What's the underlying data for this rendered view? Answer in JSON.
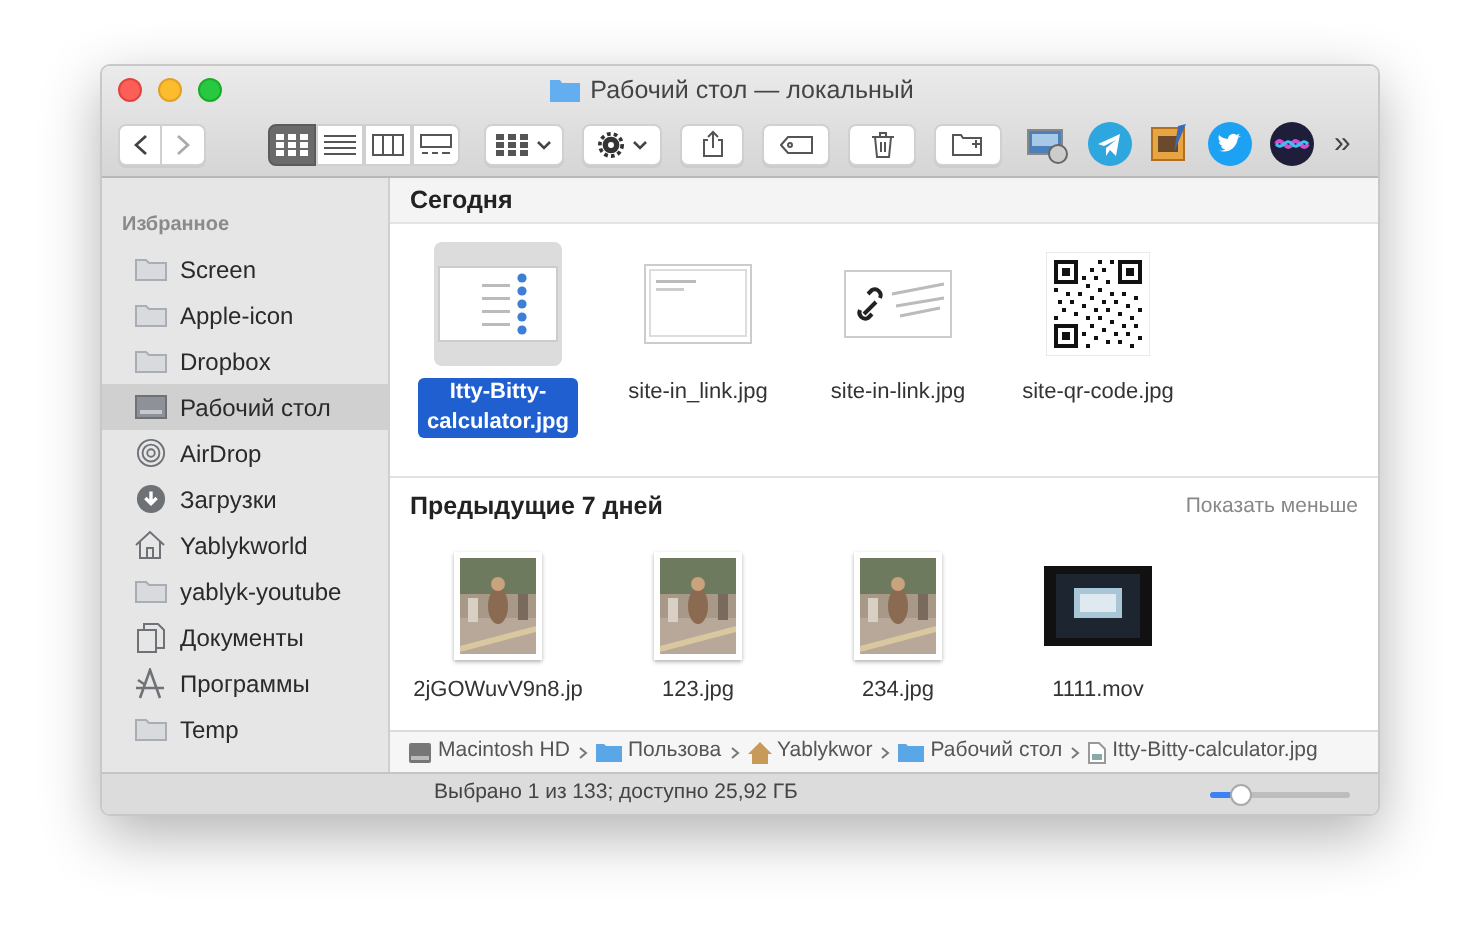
{
  "window": {
    "title": "Рабочий стол — локальный"
  },
  "toolbar": {
    "view_modes": [
      {
        "kind": "icons",
        "selected": true
      },
      {
        "kind": "list",
        "selected": false
      },
      {
        "kind": "columns",
        "selected": false
      },
      {
        "kind": "gallery",
        "selected": false
      }
    ],
    "overflow": "»"
  },
  "sidebar": {
    "section": "Избранное",
    "items": [
      {
        "label": "Screen",
        "kind": "folder",
        "selected": false
      },
      {
        "label": "Apple-icon",
        "kind": "folder",
        "selected": false
      },
      {
        "label": "Dropbox",
        "kind": "folder",
        "selected": false
      },
      {
        "label": "Рабочий стол",
        "kind": "desktop",
        "selected": true
      },
      {
        "label": "AirDrop",
        "kind": "airdrop",
        "selected": false
      },
      {
        "label": "Загрузки",
        "kind": "download",
        "selected": false
      },
      {
        "label": "Yablykworld",
        "kind": "home",
        "selected": false
      },
      {
        "label": "yablyk-youtube",
        "kind": "folder",
        "selected": false
      },
      {
        "label": "Документы",
        "kind": "documents",
        "selected": false
      },
      {
        "label": "Программы",
        "kind": "apps",
        "selected": false
      },
      {
        "label": "Temp",
        "kind": "folder",
        "selected": false
      }
    ]
  },
  "sections": [
    {
      "title": "Сегодня",
      "files": [
        {
          "name": "Itty-Bitty-calculator.jpg",
          "kind": "calculator",
          "selected": true
        },
        {
          "name": "site-in_link.jpg",
          "kind": "screenshot",
          "selected": false
        },
        {
          "name": "site-in-link.jpg",
          "kind": "link",
          "selected": false
        },
        {
          "name": "site-qr-code.jpg",
          "kind": "qr",
          "selected": false
        }
      ]
    },
    {
      "title": "Предыдущие 7 дней",
      "action": "Показать меньше",
      "files": [
        {
          "name": "2jGOWuvV9n8.jp",
          "selected": false
        },
        {
          "name": "123.jpg",
          "selected": false
        },
        {
          "name": "234.jpg",
          "selected": false
        },
        {
          "name": "1111.mov",
          "kind": "video",
          "selected": false
        }
      ]
    }
  ],
  "path_bar": [
    {
      "label": "Macintosh HD",
      "kind": "disk"
    },
    {
      "label": "Пользова",
      "kind": "folder"
    },
    {
      "label": "Yablykwor",
      "kind": "home"
    },
    {
      "label": "Рабочий стол",
      "kind": "folder"
    },
    {
      "label": "Itty-Bitty-calculator.jpg",
      "kind": "file"
    }
  ],
  "status_bar": {
    "text": "Выбрано 1 из 133; доступно 25,92 ГБ",
    "zoom": {
      "level": 0.22
    }
  }
}
